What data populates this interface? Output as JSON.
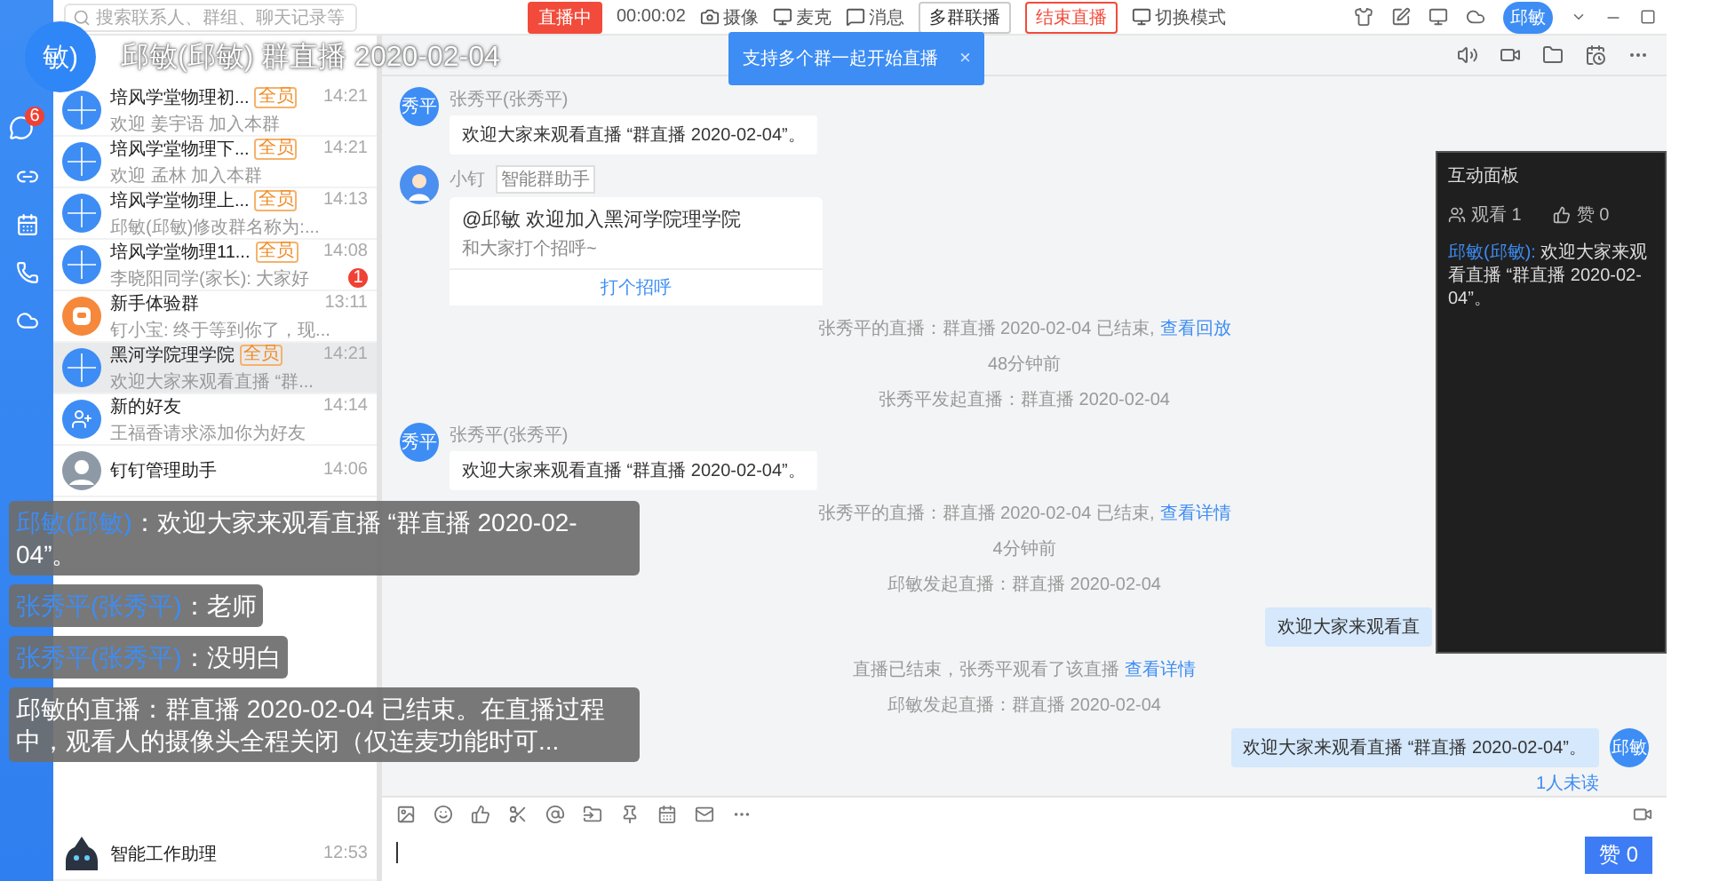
{
  "top_bar": {
    "search": {
      "placeholder": "搜索联系人、群组、聊天记录等"
    },
    "live": {
      "status": "直播中",
      "timer": "00:00:02",
      "tools": [
        {
          "label": "摄像",
          "kind": "camera"
        },
        {
          "label": "麦克",
          "kind": "screen"
        },
        {
          "label": "消息",
          "kind": "message"
        }
      ],
      "multi_group": "多群联播",
      "end": "结束直播",
      "mode": "切换模式"
    },
    "user": "邱敏"
  },
  "rail": {
    "badge": "6"
  },
  "conversations": [
    {
      "kind": "group",
      "title": "培风学堂物理初...",
      "tag": "全员",
      "time": "14:21",
      "preview": "欢迎 姜宇语 加入本群",
      "selected": false
    },
    {
      "kind": "group",
      "title": "培风学堂物理下...",
      "tag": "全员",
      "time": "14:21",
      "preview": "欢迎 孟林 加入本群",
      "selected": false
    },
    {
      "kind": "group",
      "title": "培风学堂物理上...",
      "tag": "全员",
      "time": "14:13",
      "preview": "邱敏(邱敏)修改群名称为:...",
      "selected": false
    },
    {
      "kind": "group",
      "title": "培风学堂物理11...",
      "tag": "全员",
      "time": "14:08",
      "preview": "李晓阳同学(家长): 大家好",
      "unread": "1",
      "selected": false
    },
    {
      "kind": "orange",
      "title": "新手体验群",
      "time": "13:11",
      "preview": "钉小宝: 终于等到你了，现...",
      "selected": false
    },
    {
      "kind": "group",
      "title": "黑河学院理学院",
      "tag": "全员",
      "time": "14:21",
      "preview": "欢迎大家来观看直播 “群...",
      "selected": true
    },
    {
      "kind": "add-friend",
      "title": "新的好友",
      "time": "14:14",
      "preview": "王福香请求添加你为好友",
      "selected": false
    },
    {
      "kind": "photo",
      "title": "钉钉管理助手",
      "time": "14:06",
      "selected": false
    },
    {
      "kind": "robot",
      "title": "智能工作助理",
      "time": "12:53",
      "selected": false
    }
  ],
  "messages": [
    {
      "kind": "incoming",
      "avatar": "秀平",
      "sender": "张秀平(张秀平)",
      "text": "欢迎大家来观看直播 “群直播 2020-02-04”。"
    },
    {
      "kind": "card",
      "sender": "小钉",
      "badge": "智能群助手",
      "heading": "@邱敏 欢迎加入黑河学院理学院",
      "body": "和大家打个招呼~",
      "action": "打个招呼"
    },
    {
      "kind": "system",
      "text": "张秀平的直播：群直播 2020-02-04 已结束,",
      "link": "查看回放"
    },
    {
      "kind": "system",
      "text": "48分钟前"
    },
    {
      "kind": "system",
      "text": "张秀平发起直播：群直播 2020-02-04"
    },
    {
      "kind": "incoming",
      "avatar": "秀平",
      "sender": "张秀平(张秀平)",
      "text": "欢迎大家来观看直播 “群直播 2020-02-04”。"
    },
    {
      "kind": "system",
      "text": "张秀平的直播：群直播 2020-02-04 已结束,",
      "link": "查看详情"
    },
    {
      "kind": "system",
      "text": "4分钟前"
    },
    {
      "kind": "system",
      "text": "邱敏发起直播：群直播 2020-02-04"
    },
    {
      "kind": "outgoing",
      "text": "欢迎大家来观看直"
    },
    {
      "kind": "system",
      "text": "直播已结束，张秀平观看了该直播",
      "link": "查看详情"
    },
    {
      "kind": "system",
      "text": "邱敏发起直播：群直播 2020-02-04"
    },
    {
      "kind": "outgoing",
      "avatar": "邱敏",
      "text": "欢迎大家来观看直播 “群直播 2020-02-04”。",
      "receipt": "1人未读"
    }
  ],
  "like_button": "赞 0",
  "tooltip": {
    "text": "支持多个群一起开始直播",
    "close": "×"
  },
  "live_title": {
    "avatar": "敏)",
    "title": "邱敏(邱敏) 群直播 2020-02-04"
  },
  "panel": {
    "title": "互动面板",
    "viewers": "观看 1",
    "likes": "赞 0",
    "comments": [
      {
        "name": "邱敏(邱敏):",
        "text": "欢迎大家来观看直播 “群直播 2020-02-04”。"
      }
    ]
  },
  "captions": [
    {
      "name": "邱敏(邱敏)",
      "text": "：欢迎大家来观看直播 “群直播 2020-02-04”。"
    },
    {
      "name": "张秀平(张秀平)",
      "text": "：老师"
    },
    {
      "name": "张秀平(张秀平)",
      "text": "：没明白"
    },
    {
      "text": "邱敏的直播：群直播 2020-02-04 已结束。在直播过程中，观看人的摄像头全程关闭（仅连麦功能时可..."
    }
  ]
}
